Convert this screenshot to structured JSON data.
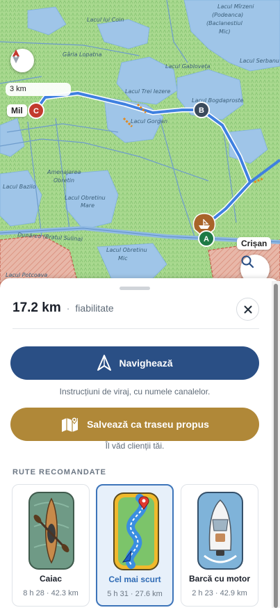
{
  "map": {
    "labels": {
      "lacul_mirzeni": "Lacul Mîrzeni",
      "podeanca": "(Podeanca)",
      "baclanestiul": "(Baclanestiul",
      "mic": "Mic)",
      "lacul_lui_coin": "Lacul lui Coin",
      "garla_lopatna": "Gârla Lopatna",
      "lacul_gabloveta": "Lacul Gabloveța",
      "lacul_serbanu": "Lacul Serbanu",
      "lacul_trei_iezere": "Lacul Trei Iezere",
      "lacul_bogdaproste": "Lacul Bogdaproste",
      "lacul_gorgan": "Lacul Gorgan",
      "amenajarea": "Amenajarea",
      "obretin": "Obretin",
      "lacul_bazilo": "Lacul Bazilo",
      "lacul_obretinu": "Lacul Obretinu",
      "mare": "Mare",
      "dunarea": "Dunărea (Bratul Sulina)",
      "lacul_obretinu_2": "Lacul Obretinu",
      "mic_2": "Mic",
      "lacul_potcoava": "Lacul Potcoava"
    },
    "scale_label": "3 km",
    "place_chips": {
      "mil": "Mil",
      "crisan": "Crișan"
    },
    "waypoints": {
      "a": "A",
      "b": "B",
      "c": "C"
    },
    "colors": {
      "route": "#3f80e0",
      "water": "#9fc5e8",
      "land": "#a8d88e"
    }
  },
  "sheet": {
    "distance": "17.2 km",
    "separator": "·",
    "reliability": "fiabilitate",
    "navigate_label": "Navighează",
    "navigate_hint": "Instrucțiuni de viraj, cu numele canalelor.",
    "save_label": "Salvează ca traseu propus",
    "save_hint": "Îl văd clienții tăi.",
    "section_title": "RUTE RECOMANDATE",
    "routes": [
      {
        "title": "Caiac",
        "meta": "8 h 28 · 42.3 km",
        "icon": "kayak-icon"
      },
      {
        "title": "Cel mai scurt",
        "meta": "5 h 31 · 27.6 km",
        "icon": "shortest-route-icon",
        "selected": true
      },
      {
        "title": "Barcă cu motor",
        "meta": "2 h 23 · 42.9 km",
        "icon": "motorboat-icon"
      }
    ],
    "colors": {
      "navigate": "#2a4f85",
      "save": "#b08838",
      "selected": "#3d74b9"
    }
  }
}
